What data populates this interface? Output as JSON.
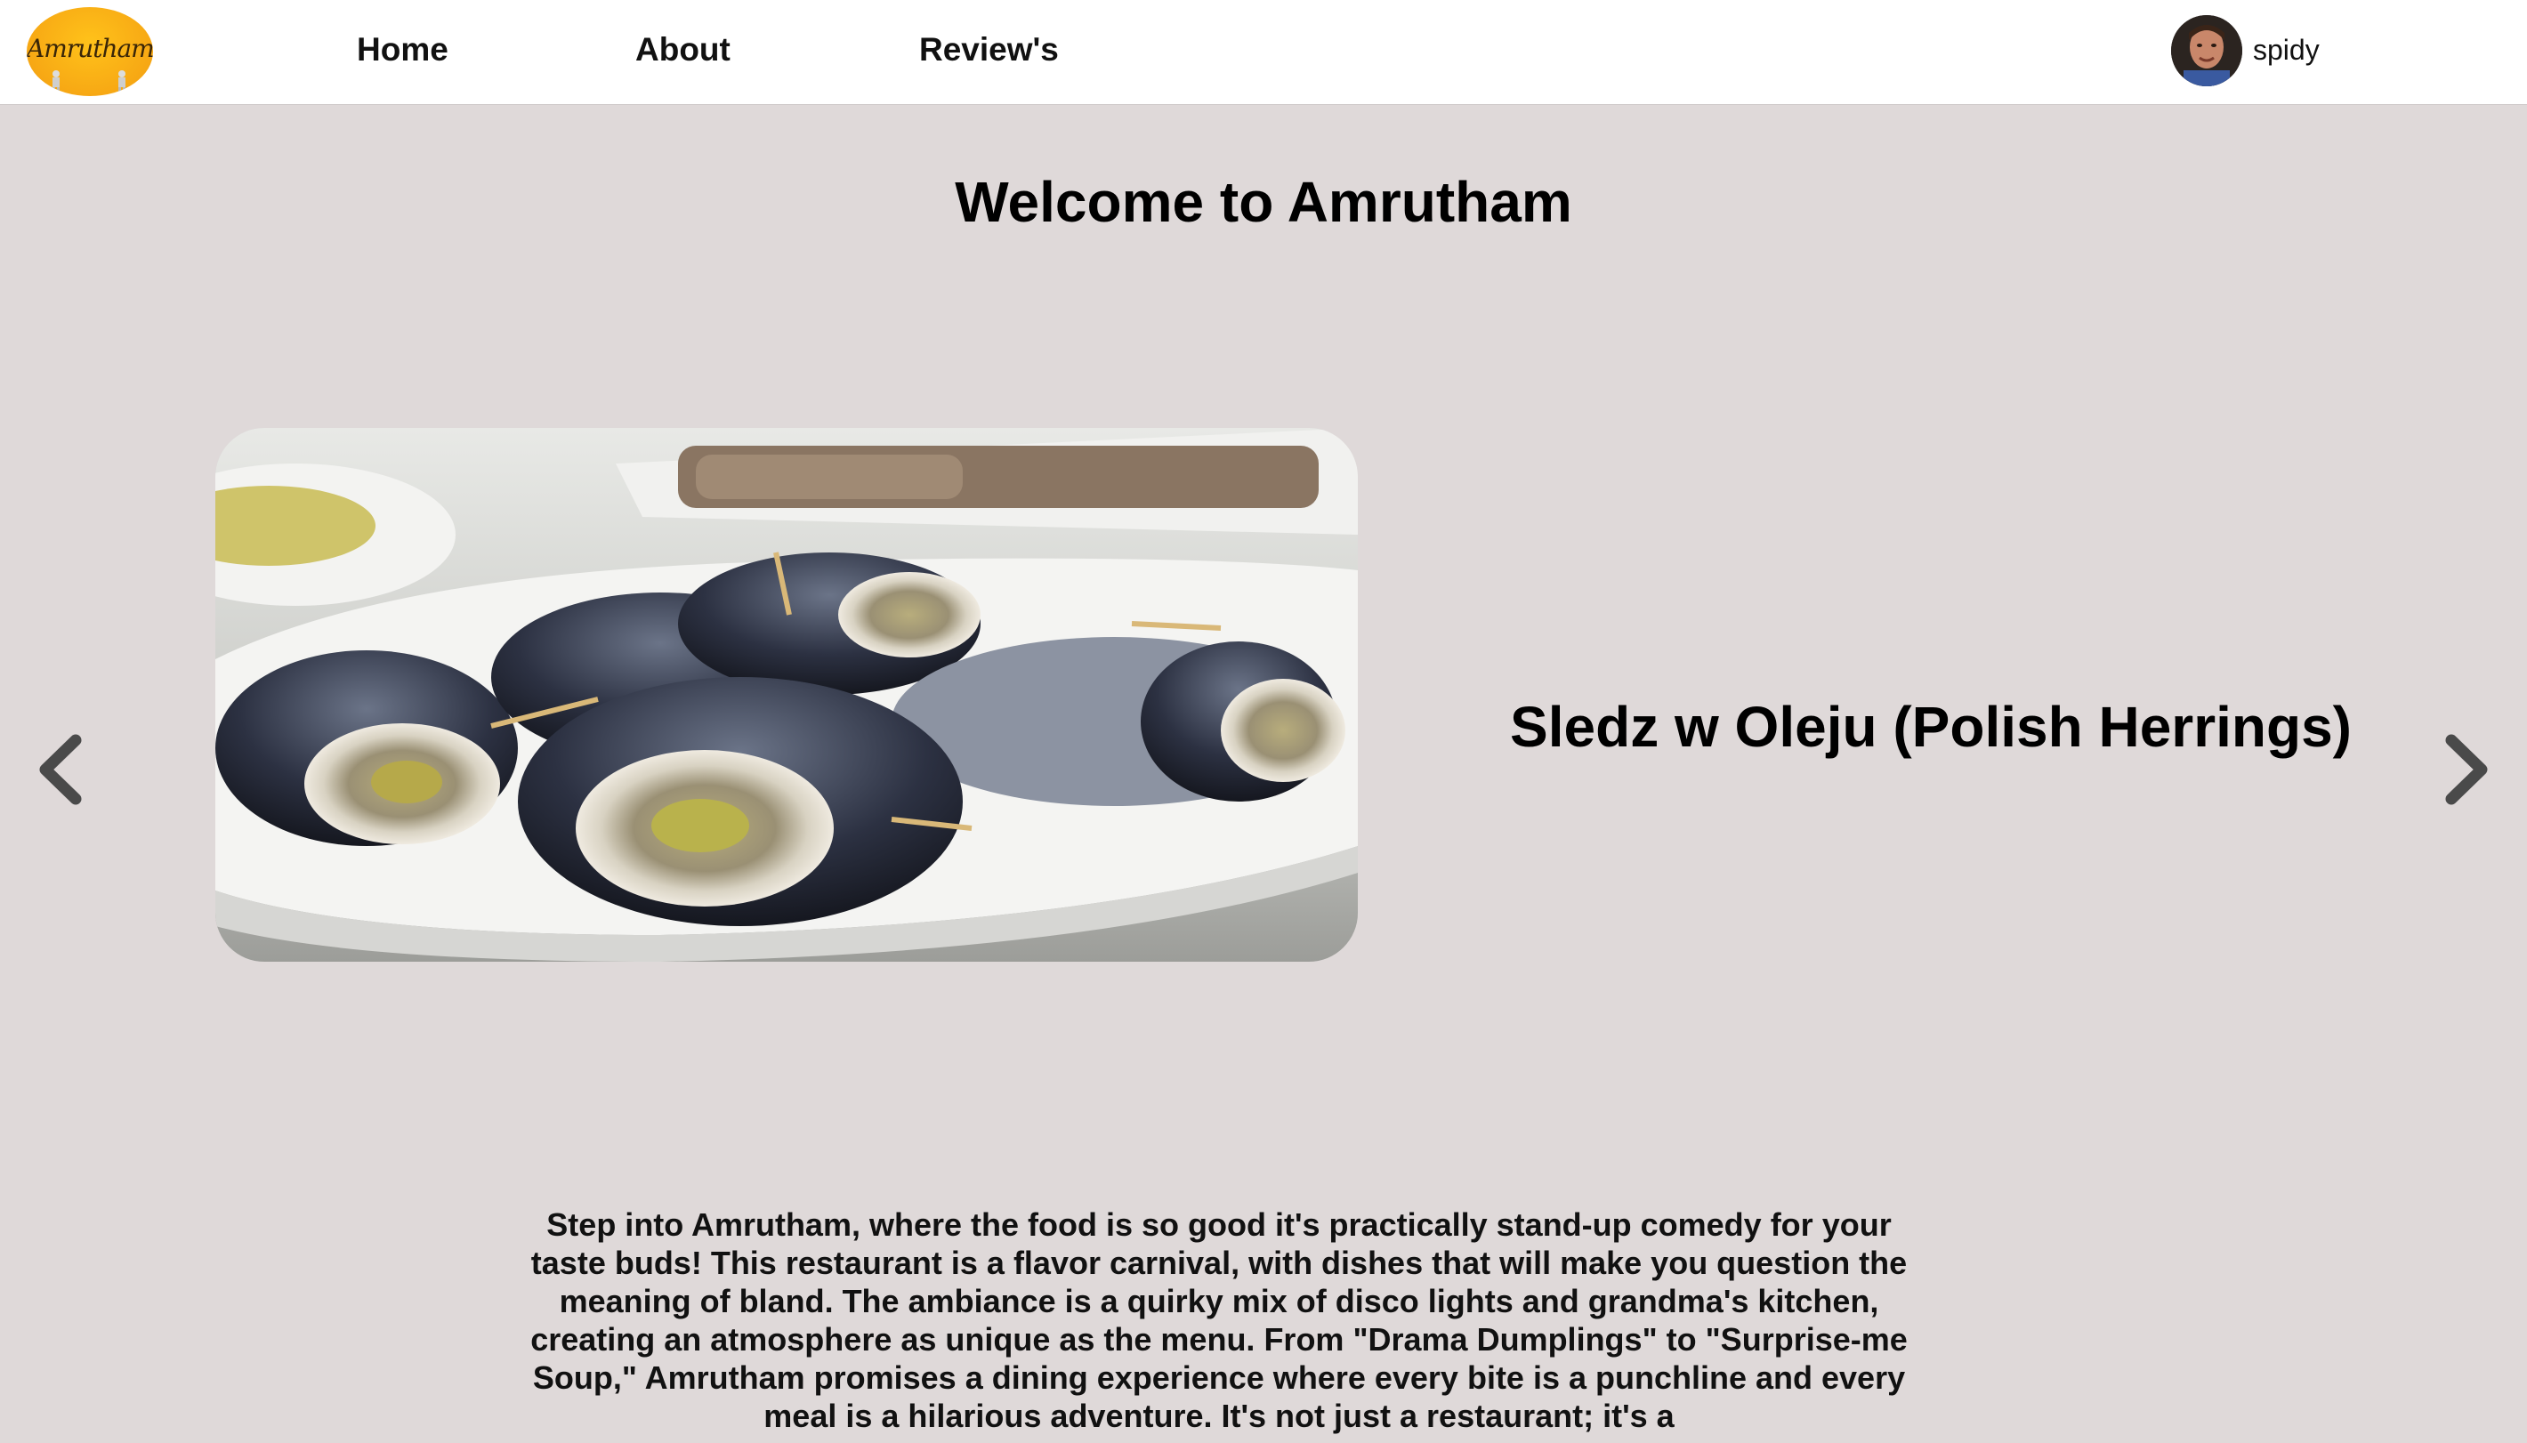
{
  "header": {
    "logo_text": "Amrutham",
    "nav": [
      {
        "label": "Home"
      },
      {
        "label": "About"
      },
      {
        "label": "Review's"
      }
    ],
    "user": {
      "name": "spidy"
    }
  },
  "main": {
    "title": "Welcome to Amrutham",
    "carousel": {
      "caption": "Sledz w Oleju (Polish Herrings)",
      "prev_icon": "chevron-left-icon",
      "next_icon": "chevron-right-icon"
    },
    "description": "Step into Amrutham, where the food is so good it's practically stand-up comedy for your taste buds! This restaurant is a flavor carnival, with dishes that will make you question the meaning of bland. The ambiance is a quirky mix of disco lights and grandma's kitchen, creating an atmosphere as unique as the menu. From \"Drama Dumplings\" to \"Surprise-me Soup,\" Amrutham promises a dining experience where every bite is a punchline and every meal is a hilarious adventure. It's not just a restaurant; it's a"
  },
  "colors": {
    "page_background": "#dfd9d9",
    "header_background": "#ffffff",
    "logo_accent": "#f7a814",
    "arrow": "#4a4a4a"
  }
}
